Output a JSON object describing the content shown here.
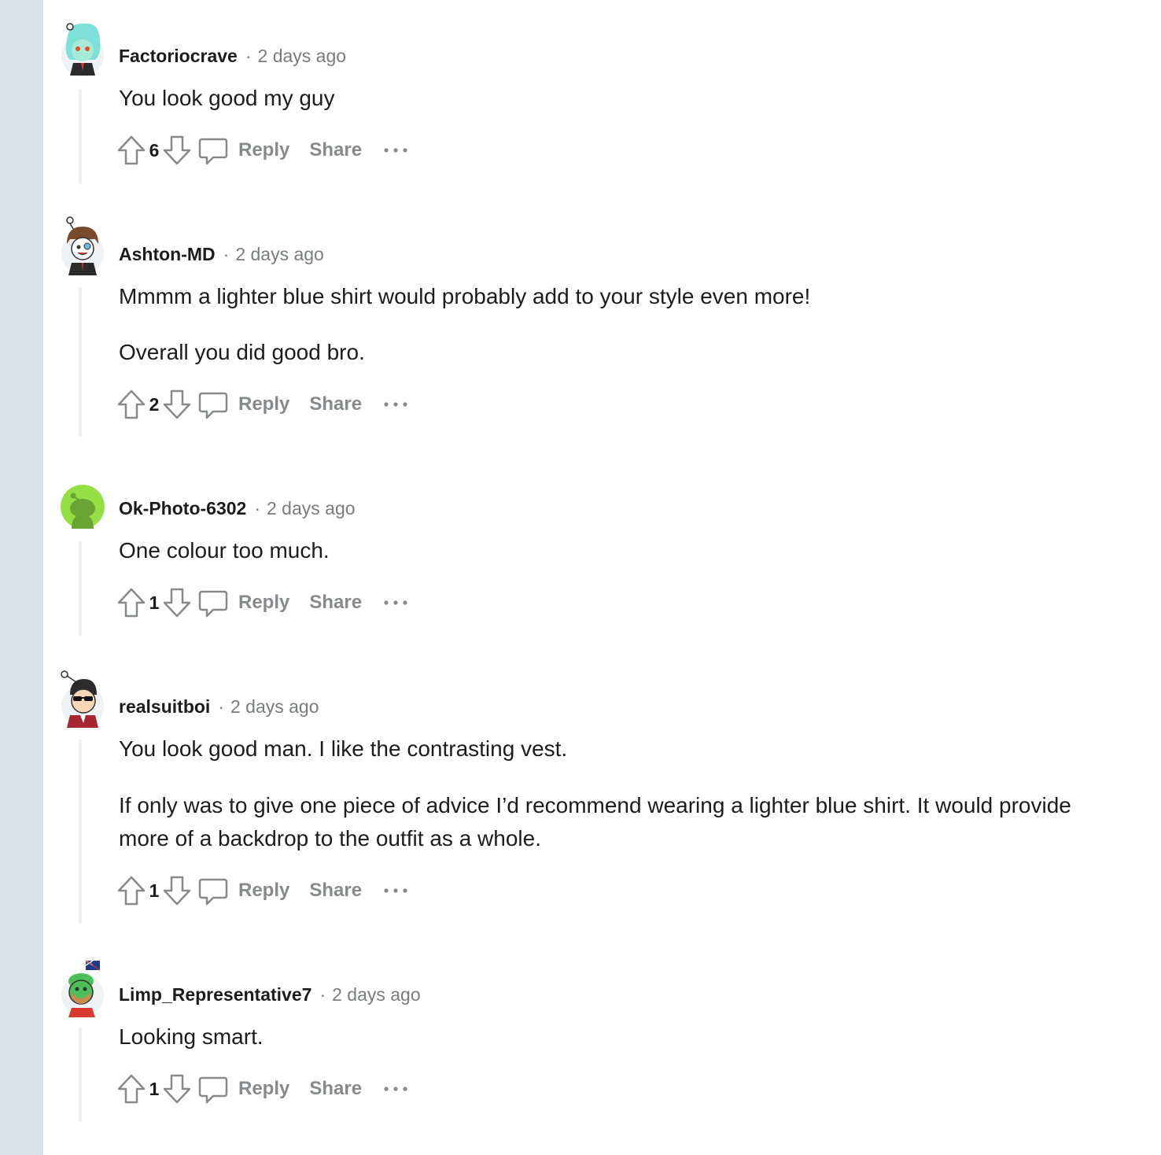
{
  "actions": {
    "reply_label": "Reply",
    "share_label": "Share"
  },
  "separator": "·",
  "comments": [
    {
      "author": "Factoriocrave",
      "timestamp": "2 days ago",
      "paragraphs": [
        "You look good my guy"
      ],
      "score": "6",
      "avatar": "factoriocrave-avatar-icon"
    },
    {
      "author": "Ashton-MD",
      "timestamp": "2 days ago",
      "paragraphs": [
        "Mmmm a lighter blue shirt would probably add to your style even more!",
        "Overall you did good bro."
      ],
      "score": "2",
      "avatar": "ashton-md-avatar-icon"
    },
    {
      "author": "Ok-Photo-6302",
      "timestamp": "2 days ago",
      "paragraphs": [
        "One colour too much."
      ],
      "score": "1",
      "avatar": "default-snoo-avatar-icon"
    },
    {
      "author": "realsuitboi",
      "timestamp": "2 days ago",
      "paragraphs": [
        "You look good man. I like the contrasting vest.",
        "If only was to give one piece of advice I’d recommend wearing a lighter blue shirt. It would provide more of a backdrop to the outfit as a whole."
      ],
      "score": "1",
      "avatar": "realsuitboi-avatar-icon"
    },
    {
      "author": "Limp_Representative7",
      "timestamp": "2 days ago",
      "paragraphs": [
        "Looking smart."
      ],
      "score": "1",
      "avatar": "limp-representative7-avatar-icon"
    }
  ],
  "colors": {
    "gutter": "#dae0e6",
    "text": "#1c1c1c",
    "meta": "#787c7e",
    "action": "#878a8c",
    "thread_line": "#edeff1",
    "default_avatar_bg": "#94e044"
  }
}
